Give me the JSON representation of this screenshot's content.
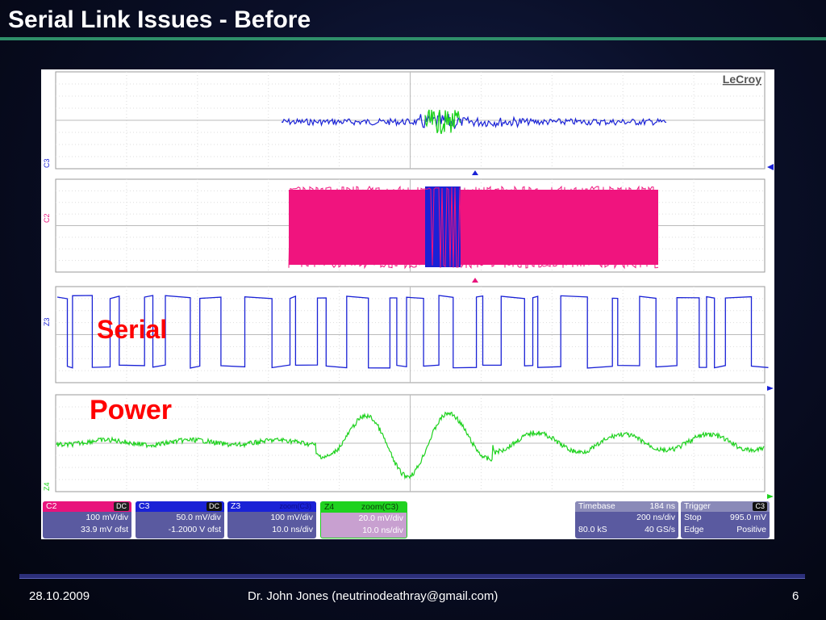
{
  "slide": {
    "title": "Serial Link Issues - Before",
    "footer_date": "28.10.2009",
    "footer_author": "Dr. John Jones (neutrinodeathray@gmail.com)",
    "footer_page": "6"
  },
  "scope": {
    "brand": "LeCroy",
    "traces": [
      {
        "label": "C3",
        "color": "#1a22d6"
      },
      {
        "label": "C2",
        "color": "#e8147c"
      },
      {
        "label": "Z3",
        "color": "#1a22d6"
      },
      {
        "label": "Z4",
        "color": "#1fd21f"
      }
    ],
    "annotations": {
      "serial": "Serial",
      "power": "Power"
    },
    "channel_panels": [
      {
        "name": "C2",
        "badge": "DC",
        "row1": "100 mV/div",
        "row2": "33.9 mV ofst",
        "color": "#e8147c"
      },
      {
        "name": "C3",
        "badge": "DC",
        "row1": "50.0 mV/div",
        "row2": "-1.2000 V ofst",
        "color": "#1a22d6"
      },
      {
        "name": "Z3",
        "badge": "zoom(C3)",
        "row1": "100 mV/div",
        "row2": "10.0 ns/div",
        "color": "#1a22d6"
      },
      {
        "name": "Z4",
        "badge": "zoom(C3)",
        "row1": "20.0 mV/div",
        "row2": "10.0 ns/div",
        "color": "#1fd21f"
      }
    ],
    "timebase": {
      "label": "Timebase",
      "value": "184 ns",
      "row1": "200 ns/div",
      "row2a": "80.0 kS",
      "row2b": "40 GS/s"
    },
    "trigger": {
      "label": "Trigger",
      "badge": "C3",
      "row1a": "Stop",
      "row1b": "995.0 mV",
      "row2a": "Edge",
      "row2b": "Positive"
    }
  }
}
